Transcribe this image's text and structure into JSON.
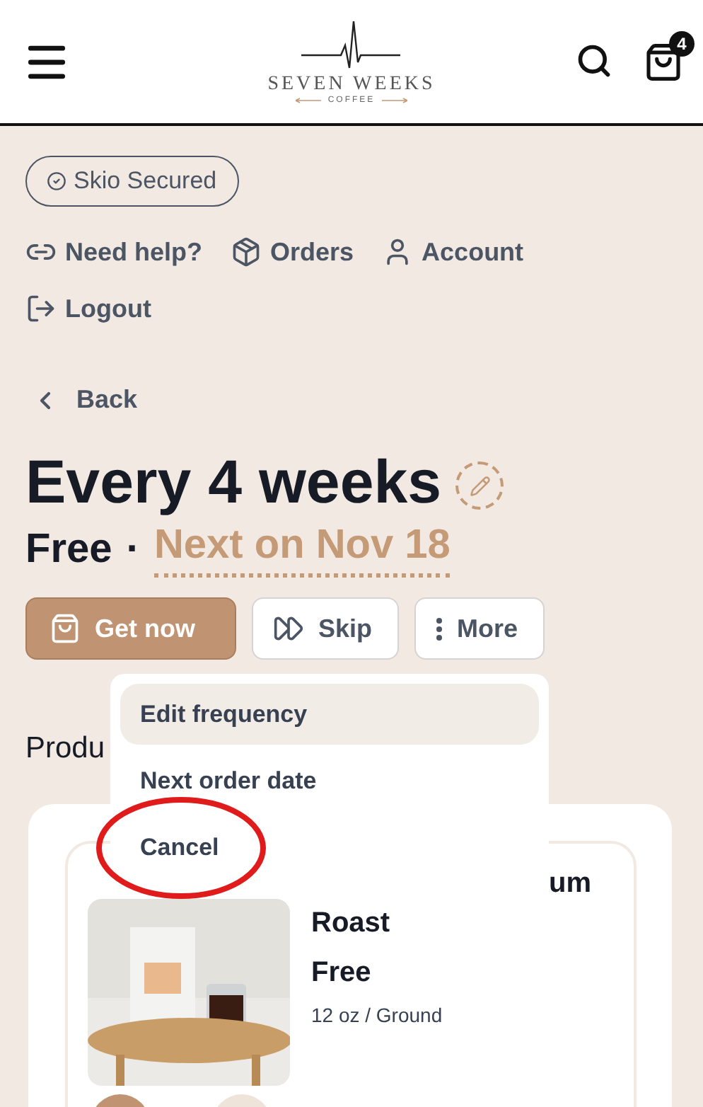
{
  "header": {
    "logo_name": "SEVEN WEEKS",
    "logo_tagline": "COFFEE",
    "cart_count": "4"
  },
  "badge": "Skio Secured",
  "nav_links": [
    {
      "label": "Need help?",
      "kind": "help"
    },
    {
      "label": "Orders",
      "kind": "orders"
    },
    {
      "label": "Account",
      "kind": "account"
    },
    {
      "label": "Logout",
      "kind": "logout"
    }
  ],
  "back": "Back",
  "title": "Every 4 weeks",
  "price": "Free",
  "separator": "·",
  "next_date": "Next on Nov 18",
  "actions": [
    {
      "label": "Get now",
      "kind": "primary"
    },
    {
      "label": "Skip",
      "kind": "skip"
    },
    {
      "label": "More",
      "kind": "more"
    }
  ],
  "menu": {
    "items": [
      {
        "label": "Edit frequency",
        "selected": true,
        "circled": false
      },
      {
        "label": "Next order date",
        "selected": false,
        "circled": false
      },
      {
        "label": "Cancel",
        "selected": false,
        "circled": true
      }
    ]
  },
  "section_heading": "Produ",
  "product": {
    "title_line_1": "um",
    "title_line_2": "Roast",
    "price": "Free",
    "variant": "12 oz / Ground"
  }
}
